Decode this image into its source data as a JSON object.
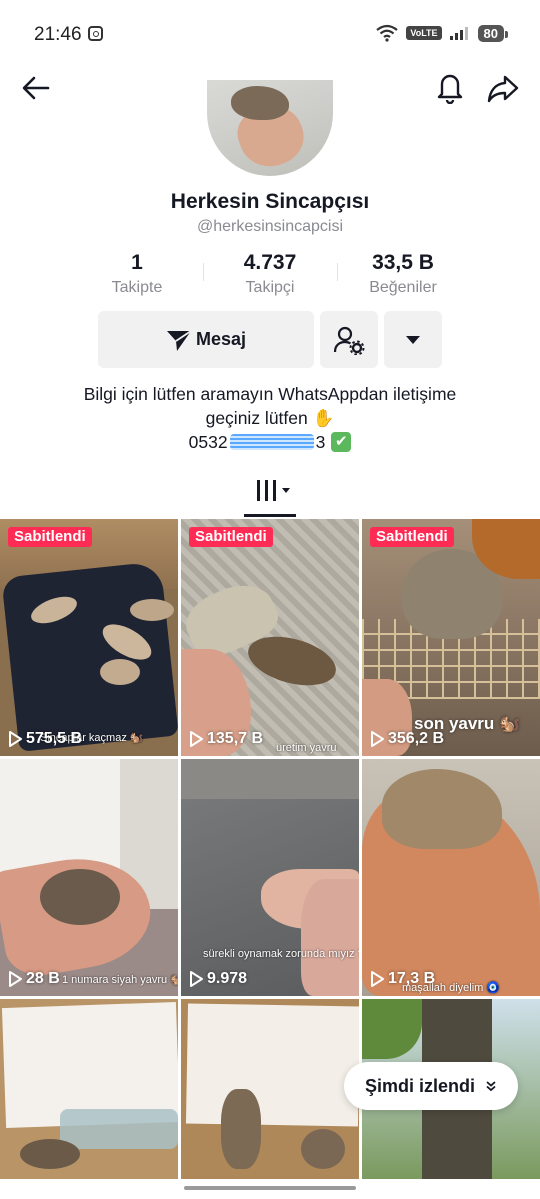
{
  "status_bar": {
    "time": "21:46",
    "volte": "VoLTE",
    "battery": "80"
  },
  "nav": {
    "icons": [
      "back-arrow-icon",
      "bell-icon",
      "share-icon"
    ]
  },
  "profile": {
    "name": "Herkesin Sincapçısı",
    "handle": "@herkesinsincapcisi"
  },
  "stats": [
    {
      "value": "1",
      "label": "Takipte"
    },
    {
      "value": "4.737",
      "label": "Takipçi"
    },
    {
      "value": "33,5 B",
      "label": "Beğeniler"
    }
  ],
  "actions": {
    "message_label": "Mesaj"
  },
  "bio": {
    "line1": "Bilgi için lütfen aramayın WhatsAppdan iletişime",
    "line2": "geçiniz lütfen ✋",
    "phone_prefix": "0532",
    "phone_suffix": "3",
    "check": "✔"
  },
  "videos": [
    {
      "pinned": "Sabitlendi",
      "views": "575,5 B",
      "caption": "Sincaplar kaçmaz 🐿️"
    },
    {
      "pinned": "Sabitlendi",
      "views": "135,7 B",
      "caption": "üretim yavru"
    },
    {
      "pinned": "Sabitlendi",
      "views": "356,2 B",
      "caption": "son yavru 🐿️"
    },
    {
      "pinned": "",
      "views": "28 B",
      "caption": "1 numara siyah yavru 🐿️"
    },
    {
      "pinned": "",
      "views": "9.978",
      "caption": "sürekli oynamak zorunda mıyız ?"
    },
    {
      "pinned": "",
      "views": "17,3 B",
      "caption": "maşallah diyelim 🧿"
    },
    {
      "pinned": "",
      "views": "",
      "caption": ""
    },
    {
      "pinned": "",
      "views": "",
      "caption": ""
    },
    {
      "pinned": "",
      "views": "",
      "caption": ""
    }
  ],
  "watched_pill": {
    "label": "Şimdi izlendi"
  },
  "colors": {
    "pin_badge": "#fe2c55",
    "button_bg": "#f1f1f2",
    "muted_text": "#8a8b91",
    "primary_text": "#161823"
  }
}
